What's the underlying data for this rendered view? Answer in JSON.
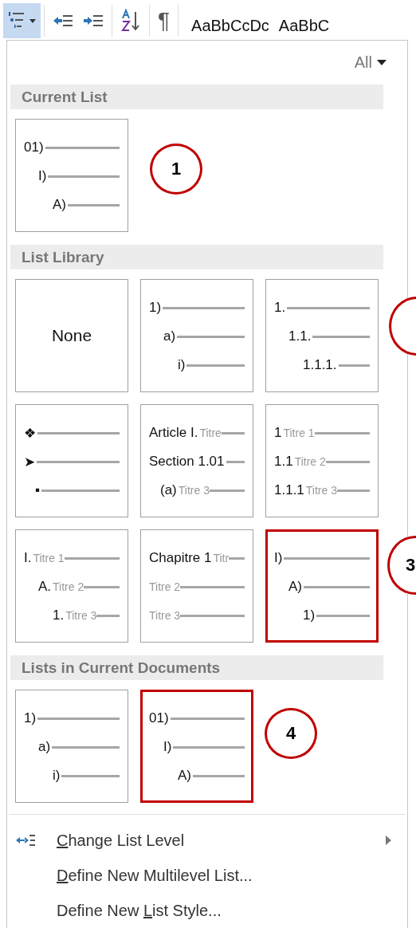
{
  "toolbar": {
    "buttons": [
      {
        "kind": "multilevel",
        "selected": true
      },
      {
        "kind": "outdent",
        "selected": false
      },
      {
        "kind": "indent",
        "selected": false
      },
      {
        "kind": "sort",
        "selected": false
      },
      {
        "kind": "pilcrow",
        "glyph": "¶",
        "selected": false
      }
    ],
    "style_previews": [
      "AaBbCcDc",
      "AaBbC"
    ]
  },
  "filter": {
    "label": "All"
  },
  "sections": [
    {
      "title": "Current List",
      "thumbnails": [
        {
          "kind": "outline",
          "highlighted": false,
          "lines": [
            {
              "number": "01)"
            },
            {
              "number": "I)"
            },
            {
              "number": "A)"
            }
          ]
        }
      ]
    },
    {
      "title": "List Library",
      "thumbnails": [
        {
          "kind": "none",
          "highlighted": false,
          "text": "None"
        },
        {
          "kind": "outline",
          "highlighted": false,
          "lines": [
            {
              "number": "1)"
            },
            {
              "number": "a)"
            },
            {
              "number": "i)"
            }
          ]
        },
        {
          "kind": "outline",
          "highlighted": false,
          "lines": [
            {
              "number": "1."
            },
            {
              "number": "1.1."
            },
            {
              "number": "1.1.1."
            }
          ]
        },
        {
          "kind": "flat",
          "highlighted": false,
          "lines": [
            {
              "number": "❖"
            },
            {
              "number": "➤"
            },
            {
              "number": "▪"
            }
          ]
        },
        {
          "kind": "flat",
          "highlighted": false,
          "lines": [
            {
              "number": "Article I.",
              "title": "Titre"
            },
            {
              "number": "Section 1.01"
            },
            {
              "number": "(a)",
              "title": "Titre 3"
            }
          ]
        },
        {
          "kind": "flat",
          "highlighted": false,
          "lines": [
            {
              "number": "1",
              "title": "Titre 1"
            },
            {
              "number": "1.1",
              "title": "Titre 2"
            },
            {
              "number": "1.1.1",
              "title": "Titre 3"
            }
          ]
        },
        {
          "kind": "outline",
          "highlighted": false,
          "lines": [
            {
              "number": "I.",
              "title": "Titre 1"
            },
            {
              "number": "A.",
              "title": "Titre 2"
            },
            {
              "number": "1.",
              "title": "Titre 3"
            }
          ]
        },
        {
          "kind": "flat",
          "highlighted": false,
          "lines": [
            {
              "number": "Chapitre 1",
              "title": "Titr"
            },
            {
              "title": "Titre 2"
            },
            {
              "title": "Titre 3"
            }
          ]
        },
        {
          "kind": "outline",
          "highlighted": true,
          "lines": [
            {
              "number": "I)"
            },
            {
              "number": "A)"
            },
            {
              "number": "1)"
            }
          ]
        }
      ]
    },
    {
      "title": "Lists in Current Documents",
      "thumbnails": [
        {
          "kind": "outline",
          "highlighted": false,
          "lines": [
            {
              "number": "1)"
            },
            {
              "number": "a)"
            },
            {
              "number": "i)"
            }
          ]
        },
        {
          "kind": "outline",
          "highlighted": true,
          "lines": [
            {
              "number": "01)"
            },
            {
              "number": "I)"
            },
            {
              "number": "A)"
            }
          ]
        }
      ]
    }
  ],
  "menu": [
    {
      "kind": "submenu",
      "key": "C",
      "rest": "hange List Level"
    },
    {
      "kind": "plain",
      "key": "D",
      "rest": "efine New Multilevel List..."
    },
    {
      "kind": "plain",
      "lead": "Define New ",
      "key": "L",
      "rest": "ist Style..."
    }
  ],
  "callouts": [
    {
      "kind": "numbered",
      "label": "1"
    },
    {
      "kind": "blank"
    },
    {
      "kind": "numbered",
      "label": "3"
    },
    {
      "kind": "numbered",
      "label": "4"
    }
  ]
}
